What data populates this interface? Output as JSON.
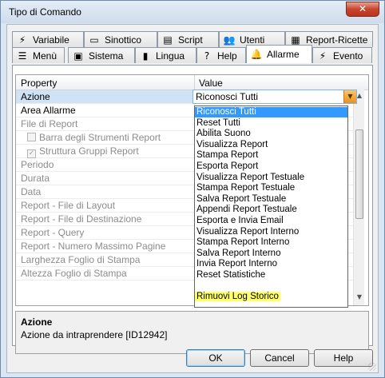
{
  "window": {
    "title": "Tipo di Comando",
    "close_glyph": "✕"
  },
  "tabs_back": [
    {
      "label": "Variabile",
      "icon": "bolt-icon",
      "glyph": "⚡"
    },
    {
      "label": "Sinottico",
      "icon": "monitor-icon",
      "glyph": "▭"
    },
    {
      "label": "Script",
      "icon": "script-icon",
      "glyph": "▤"
    },
    {
      "label": "Utenti",
      "icon": "users-icon",
      "glyph": "👥"
    },
    {
      "label": "Report-Ricette",
      "icon": "report-icon",
      "glyph": "▦"
    }
  ],
  "tabs_front": [
    {
      "label": "Menù",
      "icon": "menu-icon",
      "glyph": "☰"
    },
    {
      "label": "Sistema",
      "icon": "system-icon",
      "glyph": "▣"
    },
    {
      "label": "Lingua",
      "icon": "book-icon",
      "glyph": "▮"
    },
    {
      "label": "Help",
      "icon": "help-icon",
      "glyph": "?"
    },
    {
      "label": "Allarme",
      "icon": "bell-icon",
      "glyph": "🔔"
    },
    {
      "label": "Evento",
      "icon": "lightning-icon",
      "glyph": "⚡"
    }
  ],
  "active_tab": "Allarme",
  "grid": {
    "header_property": "Property",
    "header_value": "Value",
    "rows": [
      {
        "name": "Azione",
        "state": "selected"
      },
      {
        "name": "Area Allarme",
        "state": "normal"
      },
      {
        "name": "File di Report",
        "state": "disabled"
      },
      {
        "name": "Barra degli Strumenti Report",
        "state": "disabled",
        "checkbox": true,
        "checked": false
      },
      {
        "name": "Struttura Gruppi Report",
        "state": "disabled",
        "checkbox": true,
        "checked": true
      },
      {
        "name": "Periodo",
        "state": "disabled"
      },
      {
        "name": "Durata",
        "state": "disabled"
      },
      {
        "name": "Data",
        "state": "disabled"
      },
      {
        "name": "Report - File di Layout",
        "state": "disabled"
      },
      {
        "name": "Report - File di Destinazione",
        "state": "disabled"
      },
      {
        "name": "Report - Query",
        "state": "disabled"
      },
      {
        "name": "Report - Numero Massimo Pagine",
        "state": "disabled"
      },
      {
        "name": "Larghezza Foglio di Stampa",
        "state": "disabled"
      },
      {
        "name": "Altezza Foglio di Stampa",
        "state": "disabled"
      }
    ]
  },
  "combo": {
    "value": "Riconosci Tutti",
    "arrow_glyph": "▼"
  },
  "dropdown": {
    "selected_index": 0,
    "highlighted_index": 17,
    "options": [
      "Riconosci Tutti",
      "Reset Tutti",
      "Abilita Suono",
      "Visualizza Report",
      "Stampa Report",
      "Esporta Report",
      "Visualizza Report Testuale",
      "Stampa Report Testuale",
      "Salva Report Testuale",
      "Appendi Report Testuale",
      "Esporta e Invia Email",
      "Visualizza Report Interno",
      "Stampa Report Interno",
      "Salva Report Interno",
      "Invia Report Interno",
      "Reset Statistiche",
      "",
      "Rimuovi Log Storico"
    ]
  },
  "scrollbar": {
    "up_glyph": "▲",
    "down_glyph": "▼"
  },
  "description": {
    "title": "Azione",
    "text": "Azione da intraprendere [ID12942]"
  },
  "buttons": {
    "ok": "OK",
    "cancel": "Cancel",
    "help": "Help"
  },
  "colors": {
    "selection": "#3399ff",
    "highlight": "#ffff66",
    "alarm_icon": "#d62a1e"
  }
}
